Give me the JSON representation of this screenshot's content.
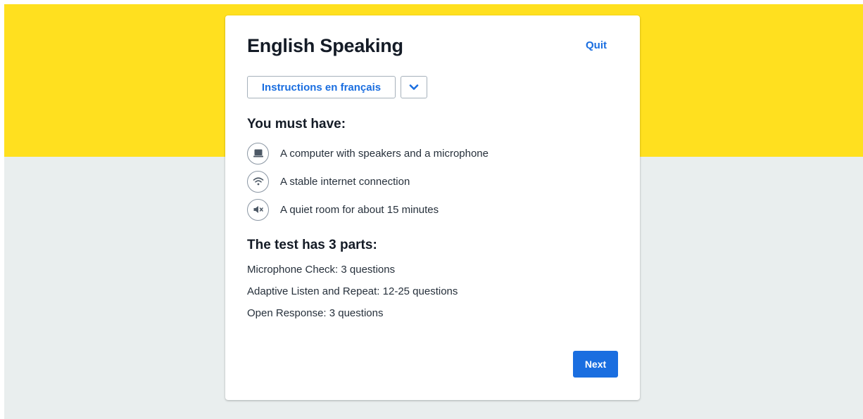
{
  "header": {
    "title": "English Speaking",
    "quit_label": "Quit"
  },
  "language": {
    "button_label": "Instructions en français",
    "toggle_icon": "chevron-down-icon"
  },
  "requirements": {
    "heading": "You must have:",
    "items": [
      {
        "icon": "laptop-icon",
        "label": "A computer with speakers and a microphone"
      },
      {
        "icon": "wifi-icon",
        "label": "A stable internet connection"
      },
      {
        "icon": "speaker-muted-icon",
        "label": "A quiet room for about 15 minutes"
      }
    ]
  },
  "test_parts": {
    "heading": "The test has 3 parts:",
    "items": [
      "Microphone Check: 3 questions",
      "Adaptive Listen and Repeat: 12-25 questions",
      "Open Response: 3 questions"
    ]
  },
  "footer": {
    "next_label": "Next"
  },
  "colors": {
    "banner": "#ffe01f",
    "background": "#e9eeee",
    "accent": "#1a6ee0",
    "text": "#141b26"
  }
}
